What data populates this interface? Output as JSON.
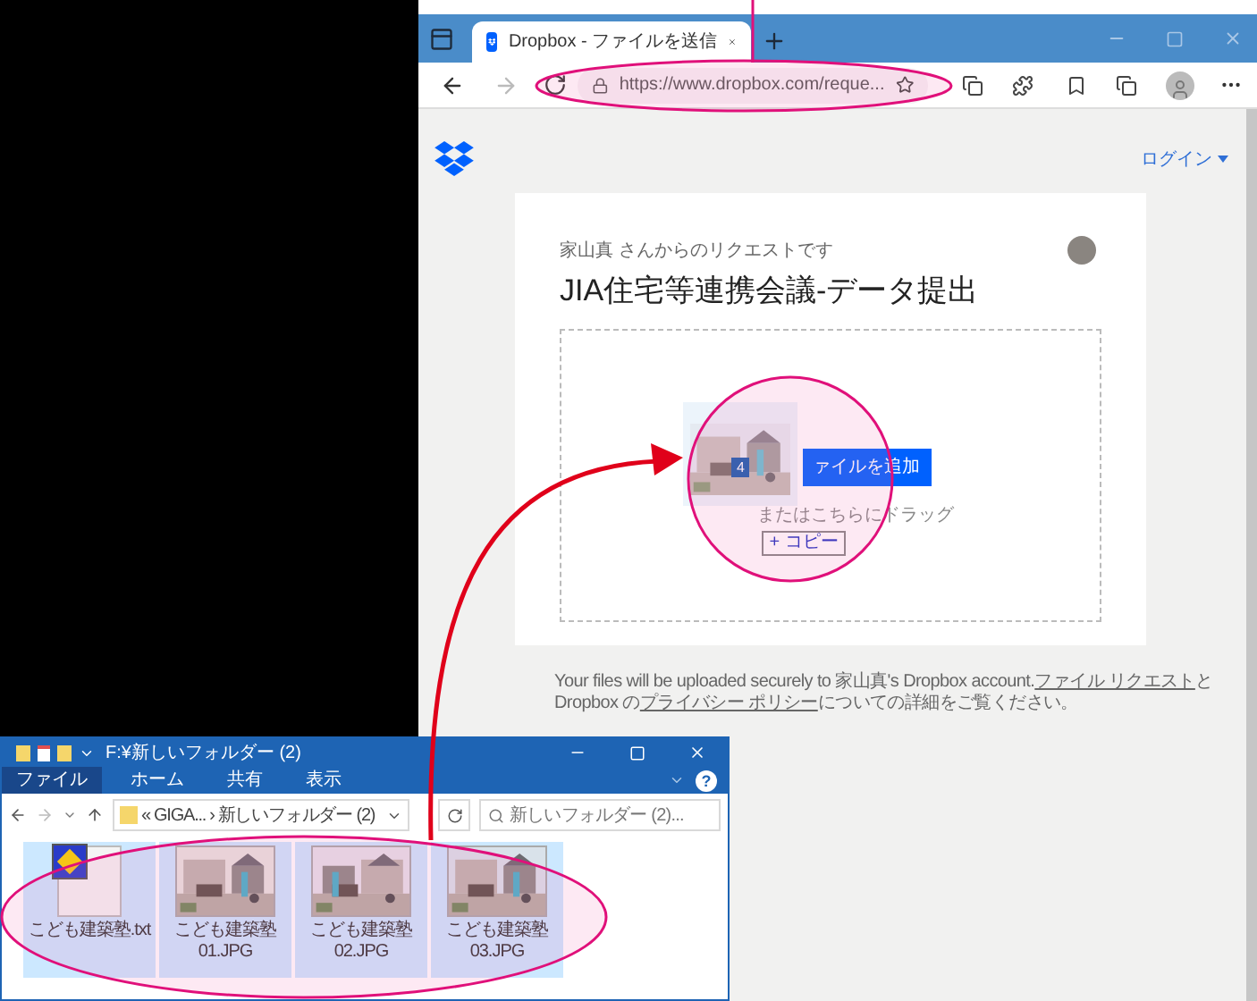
{
  "browser": {
    "tab_title": "Dropbox - ファイルを送信",
    "url": "https://www.dropbox.com/reque...",
    "login": "ログイン",
    "request": {
      "requester": "家山真 さんからのリクエストです",
      "title": "JIA住宅等連携会議-データ提出",
      "add_button": "ァイルを追加",
      "drag_hint": "またはこちらにドラッグ",
      "drag_count": "4",
      "drop_effect": "+ コピー"
    },
    "footer": [
      {
        "kind": "text",
        "text": "Your files will be uploaded securely to 家山真's Dropbox account."
      },
      {
        "kind": "link",
        "text": "ファイル リクエスト"
      },
      {
        "kind": "text",
        "text": "と Dropbox の"
      },
      {
        "kind": "link",
        "text": "プライバシー ポリシー"
      },
      {
        "kind": "text",
        "text": "についての詳細をご覧ください。"
      }
    ]
  },
  "explorer": {
    "title": "F:¥新しいフォルダー (2)",
    "ribbon_tabs": [
      {
        "label": "ファイル",
        "selected": true
      },
      {
        "label": "ホーム",
        "selected": false
      },
      {
        "label": "共有",
        "selected": false
      },
      {
        "label": "表示",
        "selected": false
      }
    ],
    "help": "?",
    "breadcrumb": [
      "«",
      "GIGA...",
      "›",
      "新しいフォルダー (2)"
    ],
    "search_placeholder": "新しいフォルダー (2)...",
    "files": [
      {
        "kind": "text",
        "name": "こども建築塾.txt",
        "selected": true
      },
      {
        "name": "こども建築塾 01.JPG",
        "selected": true
      },
      {
        "name": "こども建築塾 02.JPG",
        "selected": true
      },
      {
        "name": "こども建築塾 03.JPG",
        "selected": true
      }
    ]
  }
}
